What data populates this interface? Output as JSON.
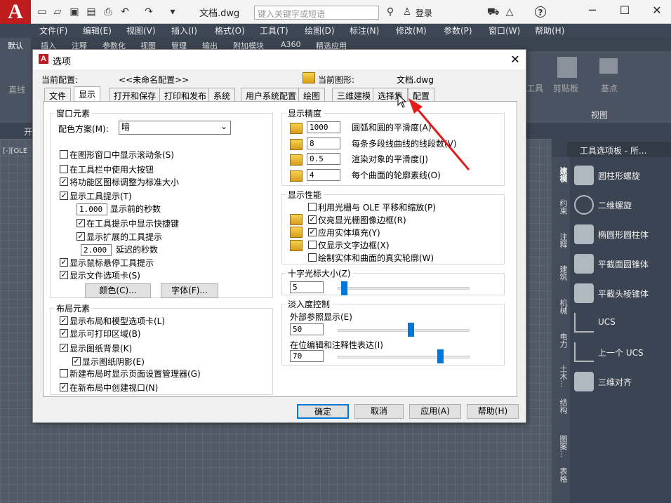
{
  "app": {
    "logo": "A",
    "filename": "文档.dwg",
    "search_placeholder": "键入关键字或短语",
    "login": "登录",
    "help": "?"
  },
  "menubar": [
    "文件(F)",
    "编辑(E)",
    "视图(V)",
    "插入(I)",
    "格式(O)",
    "工具(T)",
    "绘图(D)",
    "标注(N)",
    "修改(M)",
    "参数(P)",
    "窗口(W)",
    "帮助(H)"
  ],
  "ribbon_tabs": [
    "默认",
    "插入",
    "注释",
    "参数化",
    "视图",
    "管理",
    "输出",
    "附加模块",
    "A360",
    "精选应用"
  ],
  "ribbon": {
    "line": "直线",
    "clipboard": "剪贴板",
    "base": "基点",
    "view": "视图",
    "tools": "工具"
  },
  "drawing": {
    "filetab": "开",
    "viewport_label": "[-][OLE"
  },
  "palette": {
    "title": "工具选项板 - 所...",
    "sidetabs": [
      "建模",
      "约束",
      "注释",
      "建筑",
      "机械",
      "电力",
      "土木...",
      "结构",
      "图案...",
      "表格"
    ],
    "items": [
      "圆柱形螺旋",
      "二维螺旋",
      "椭圆形圆柱体",
      "平截面圆锥体",
      "平截头棱锥体",
      "UCS",
      "上一个 UCS",
      "三维对齐"
    ]
  },
  "dialog": {
    "title": "选项",
    "current_profile_label": "当前配置:",
    "current_profile_value": "<<未命名配置>>",
    "current_drawing_label": "当前图形:",
    "current_drawing_value": "文档.dwg",
    "tabs": [
      "文件",
      "显示",
      "打开和保存",
      "打印和发布",
      "系统",
      "用户系统配置",
      "绘图",
      "三维建模",
      "选择集",
      "配置"
    ],
    "window_elements": {
      "title": "窗口元素",
      "color_scheme_label": "配色方案(M):",
      "color_scheme_value": "暗",
      "checks": [
        {
          "label": "在图形窗口中显示滚动条(S)",
          "checked": false
        },
        {
          "label": "在工具栏中使用大按钮",
          "checked": false
        },
        {
          "label": "将功能区图标调整为标准大小",
          "checked": true
        },
        {
          "label": "显示工具提示(T)",
          "checked": true
        }
      ],
      "tooltip_delay_value": "1.000",
      "tooltip_delay_label": "显示前的秒数",
      "sub_checks": [
        {
          "label": "在工具提示中显示快捷键",
          "checked": true
        },
        {
          "label": "显示扩展的工具提示",
          "checked": true
        }
      ],
      "extended_delay_value": "2.000",
      "extended_delay_label": "延迟的秒数",
      "checks2": [
        {
          "label": "显示鼠标悬停工具提示",
          "checked": true
        },
        {
          "label": "显示文件选项卡(S)",
          "checked": true
        }
      ],
      "colors_button": "颜色(C)...",
      "fonts_button": "字体(F)..."
    },
    "layout_elements": {
      "title": "布局元素",
      "checks": [
        {
          "label": "显示布局和模型选项卡(L)",
          "checked": true
        },
        {
          "label": "显示可打印区域(B)",
          "checked": true
        },
        {
          "label": "显示图纸背景(K)",
          "checked": true
        },
        {
          "label": "显示图纸阴影(E)",
          "checked": true
        },
        {
          "label": "新建布局时显示页面设置管理器(G)",
          "checked": false
        },
        {
          "label": "在新布局中创建视口(N)",
          "checked": true
        }
      ]
    },
    "display_resolution": {
      "title": "显示精度",
      "rows": [
        {
          "value": "1000",
          "label": "圆弧和圆的平滑度(A)"
        },
        {
          "value": "8",
          "label": "每条多段线曲线的线段数(V)"
        },
        {
          "value": "0.5",
          "label": "渲染对象的平滑度(J)"
        },
        {
          "value": "4",
          "label": "每个曲面的轮廓素线(O)"
        }
      ]
    },
    "display_performance": {
      "title": "显示性能",
      "checks": [
        {
          "label": "利用光栅与 OLE 平移和缩放(P)",
          "checked": false
        },
        {
          "label": "仅亮显光栅图像边框(R)",
          "checked": true
        },
        {
          "label": "应用实体填充(Y)",
          "checked": true
        },
        {
          "label": "仅显示文字边框(X)",
          "checked": false
        },
        {
          "label": "绘制实体和曲面的真实轮廓(W)",
          "checked": false
        }
      ]
    },
    "crosshair": {
      "title": "十字光标大小(Z)",
      "value": "5",
      "level": 5
    },
    "fade": {
      "title": "淡入度控制",
      "xref_label": "外部参照显示(E)",
      "xref_value": "50",
      "xref_level": 50,
      "inplace_label": "在位编辑和注释性表达(I)",
      "inplace_value": "70",
      "inplace_level": 70
    },
    "buttons": {
      "ok": "确定",
      "cancel": "取消",
      "apply": "应用(A)",
      "help": "帮助(H)"
    }
  }
}
